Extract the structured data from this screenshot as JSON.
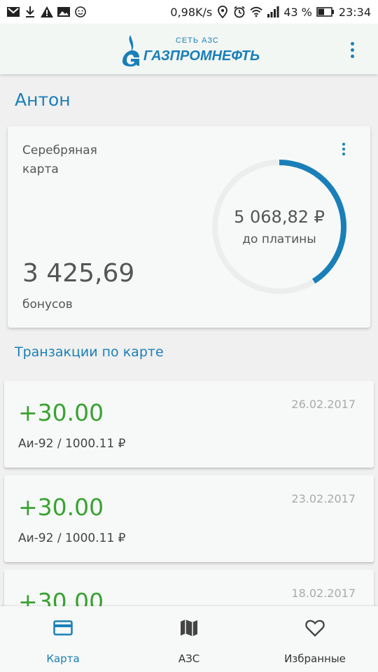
{
  "status_bar": {
    "speed": "0,98K/s",
    "battery": "43 %",
    "time": "23:34",
    "icons": [
      "gmail-icon",
      "download-icon",
      "warning-icon",
      "image-icon",
      "face-icon",
      "location-icon",
      "alarm-icon",
      "wifi-icon",
      "signal-icon",
      "battery-icon"
    ]
  },
  "header": {
    "logo_sub": "СЕТЬ АЗС",
    "logo_main": "ГАЗПРОМНЕФТЬ",
    "menu_icon": "more-vertical-icon"
  },
  "user": {
    "name": "Антон"
  },
  "card": {
    "type": "Серебряная карта",
    "bonus_value": "3 425,69",
    "bonus_label": "бонусов",
    "remaining_amount": "5 068,82 ₽",
    "remaining_label": "до платины",
    "progress_fraction": 0.41
  },
  "transactions": {
    "title": "Транзакции по карте",
    "items": [
      {
        "amount": "+30.00",
        "date": "26.02.2017",
        "description": "Аи-92 / 1000.11 ₽"
      },
      {
        "amount": "+30.00",
        "date": "23.02.2017",
        "description": "Аи-92 / 1000.11 ₽"
      },
      {
        "amount": "+30.00",
        "date": "18.02.2017",
        "description": ""
      }
    ]
  },
  "bottom_nav": {
    "items": [
      {
        "label": "Карта",
        "icon": "card-icon",
        "active": true
      },
      {
        "label": "АЗС",
        "icon": "map-icon",
        "active": false
      },
      {
        "label": "Избранные",
        "icon": "heart-icon",
        "active": false
      }
    ]
  },
  "colors": {
    "accent": "#1a7fb8",
    "positive": "#3aa232",
    "text": "#555555",
    "muted": "#aaaaaa"
  }
}
